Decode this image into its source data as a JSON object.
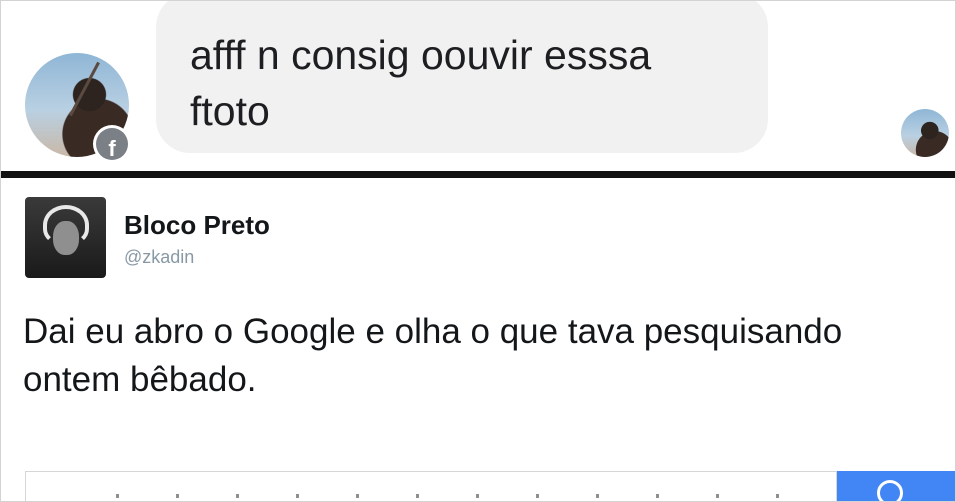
{
  "chat": {
    "message": "afff n consig oouvir esssa ftoto",
    "badge_icon": "facebook-icon",
    "badge_glyph": "f"
  },
  "tweet": {
    "name": "Bloco Preto",
    "handle": "@zkadin",
    "text": "Dai eu abro o Google e olha o que tava pesquisando ontem bêbado."
  },
  "search": {
    "icon": "search-icon",
    "button_color": "#4285f4"
  }
}
